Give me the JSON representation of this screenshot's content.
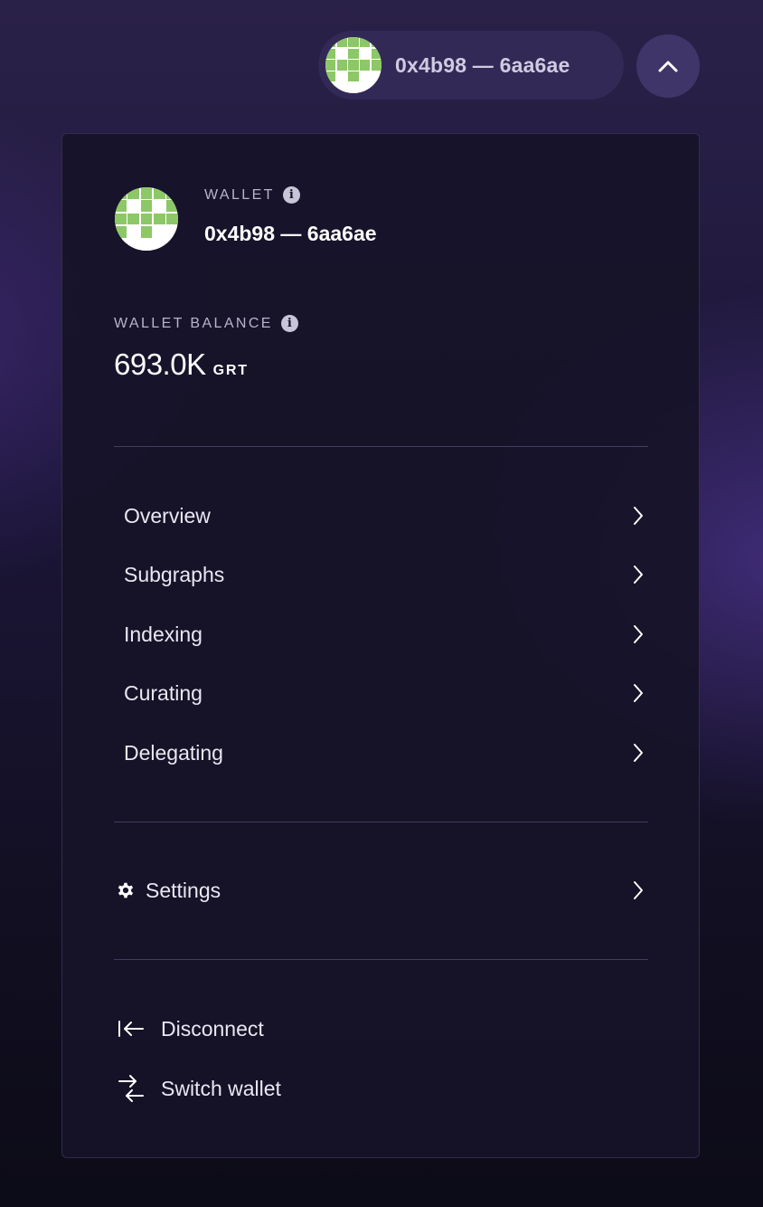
{
  "header": {
    "wallet_short": "0x4b98 — 6aa6ae",
    "avatar_icon": "identicon-avatar",
    "toggle_icon": "chevron-up-icon"
  },
  "panel": {
    "wallet_label": "WALLET",
    "wallet_address": "0x4b98 — 6aa6ae",
    "balance_label": "WALLET BALANCE",
    "balance_value": "693.0K",
    "balance_unit": "GRT",
    "nav": [
      {
        "label": "Overview"
      },
      {
        "label": "Subgraphs"
      },
      {
        "label": "Indexing"
      },
      {
        "label": "Curating"
      },
      {
        "label": "Delegating"
      }
    ],
    "settings_label": "Settings",
    "actions": {
      "disconnect": "Disconnect",
      "switch_wallet": "Switch wallet"
    }
  },
  "colors": {
    "identicon_green": "#8cc768",
    "panel_bg": "#161328",
    "accent_text": "#b9b4cc"
  }
}
